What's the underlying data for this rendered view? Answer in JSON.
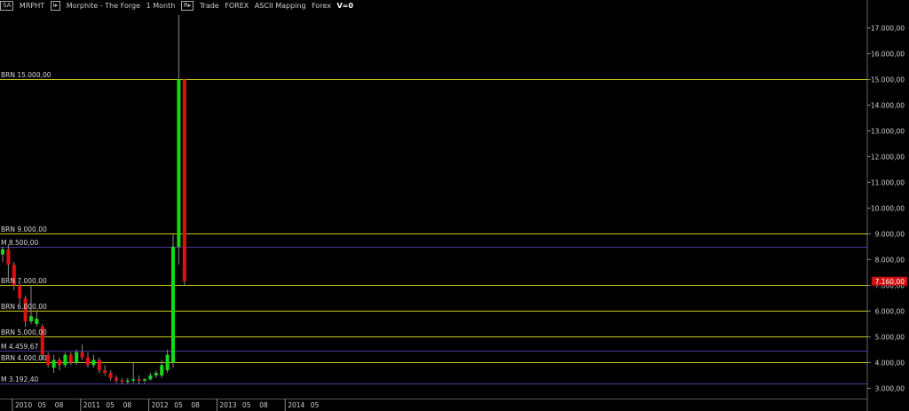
{
  "header": {
    "symbol_box": "SA",
    "symbol": "MRPHT",
    "box2": "I▸",
    "title": "Morphite - The Forge",
    "period": "1 Month",
    "box3": "R▸",
    "mode": "Trade",
    "market": "FOREX",
    "mapping": "ASCII Mapping",
    "market2": "Forex",
    "vol": "V=0"
  },
  "colors": {
    "up": "#16d916",
    "down": "#e01010",
    "brn_line": "#c8c81e",
    "m_line": "#4a3aa0",
    "axis_text": "#d0d0d0",
    "price_tag": "#d01010"
  },
  "chart_data": {
    "type": "candlestick",
    "ylim": [
      2600,
      17600
    ],
    "y_ticks": [
      {
        "value": 3000,
        "label": "3.000,00"
      },
      {
        "value": 4000,
        "label": "4.000,00"
      },
      {
        "value": 5000,
        "label": "5.000,00"
      },
      {
        "value": 6000,
        "label": "6.000,00"
      },
      {
        "value": 7000,
        "label": "7.000,00"
      },
      {
        "value": 8000,
        "label": "8.000,00"
      },
      {
        "value": 9000,
        "label": "9.000,00"
      },
      {
        "value": 10000,
        "label": "10.000,00"
      },
      {
        "value": 11000,
        "label": "11.000,00"
      },
      {
        "value": 12000,
        "label": "12.000,00"
      },
      {
        "value": 13000,
        "label": "13.000,00"
      },
      {
        "value": 14000,
        "label": "14.000,00"
      },
      {
        "value": 15000,
        "label": "15.000,00"
      },
      {
        "value": 16000,
        "label": "16.000,00"
      },
      {
        "value": 17000,
        "label": "17.000,00"
      }
    ],
    "x_labels": [
      {
        "index": 0,
        "label": "2010",
        "year": true
      },
      {
        "index": 4,
        "label": "05",
        "year": false
      },
      {
        "index": 7,
        "label": "08",
        "year": false
      },
      {
        "index": 12,
        "label": "2011",
        "year": true
      },
      {
        "index": 16,
        "label": "05",
        "year": false
      },
      {
        "index": 19,
        "label": "08",
        "year": false
      },
      {
        "index": 24,
        "label": "2012",
        "year": true
      },
      {
        "index": 28,
        "label": "05",
        "year": false
      },
      {
        "index": 31,
        "label": "08",
        "year": false
      },
      {
        "index": 36,
        "label": "2013",
        "year": true
      },
      {
        "index": 40,
        "label": "05",
        "year": false
      },
      {
        "index": 43,
        "label": "08",
        "year": false
      },
      {
        "index": 48,
        "label": "2014",
        "year": true
      },
      {
        "index": 52,
        "label": "05",
        "year": false
      }
    ],
    "hlines": [
      {
        "value": 15000,
        "label": "BRN 15.000,00",
        "kind": "brn"
      },
      {
        "value": 9000,
        "label": "BRN 9.000,00",
        "kind": "brn"
      },
      {
        "value": 8500,
        "label": "M 8.500,00",
        "kind": "m"
      },
      {
        "value": 7000,
        "label": "BRN 7.000,00",
        "kind": "brn"
      },
      {
        "value": 6000,
        "label": "BRN 6.000,00",
        "kind": "brn"
      },
      {
        "value": 5000,
        "label": "BRN 5.000,00",
        "kind": "brn"
      },
      {
        "value": 4459.67,
        "label": "M 4.459,67",
        "kind": "m"
      },
      {
        "value": 4000,
        "label": "BRN 4.000,00",
        "kind": "brn"
      },
      {
        "value": 3192.4,
        "label": "M 3.192,40",
        "kind": "m"
      }
    ],
    "last_price": {
      "value": 7160,
      "label": "7.160,00"
    },
    "candles": [
      {
        "o": 8200,
        "h": 8500,
        "l": 7900,
        "c": 8400
      },
      {
        "o": 8400,
        "h": 8600,
        "l": 7300,
        "c": 7800
      },
      {
        "o": 7800,
        "h": 7900,
        "l": 6800,
        "c": 7000
      },
      {
        "o": 7000,
        "h": 7100,
        "l": 6300,
        "c": 6500
      },
      {
        "o": 6500,
        "h": 6600,
        "l": 5400,
        "c": 5600
      },
      {
        "o": 5600,
        "h": 7000,
        "l": 5500,
        "c": 5800
      },
      {
        "o": 5500,
        "h": 6000,
        "l": 5400,
        "c": 5700
      },
      {
        "o": 5400,
        "h": 5500,
        "l": 4100,
        "c": 4300
      },
      {
        "o": 4300,
        "h": 4400,
        "l": 3800,
        "c": 3900
      },
      {
        "o": 3800,
        "h": 4300,
        "l": 3600,
        "c": 4100
      },
      {
        "o": 4100,
        "h": 4200,
        "l": 3700,
        "c": 3900
      },
      {
        "o": 3900,
        "h": 4400,
        "l": 3800,
        "c": 4300
      },
      {
        "o": 4300,
        "h": 4400,
        "l": 3900,
        "c": 4000
      },
      {
        "o": 4000,
        "h": 4500,
        "l": 3900,
        "c": 4400
      },
      {
        "o": 4400,
        "h": 4700,
        "l": 4100,
        "c": 4200
      },
      {
        "o": 4200,
        "h": 4400,
        "l": 3800,
        "c": 3900
      },
      {
        "o": 3900,
        "h": 4300,
        "l": 3800,
        "c": 4100
      },
      {
        "o": 4100,
        "h": 4200,
        "l": 3600,
        "c": 3700
      },
      {
        "o": 3700,
        "h": 3900,
        "l": 3500,
        "c": 3600
      },
      {
        "o": 3600,
        "h": 3700,
        "l": 3300,
        "c": 3400
      },
      {
        "o": 3400,
        "h": 3500,
        "l": 3200,
        "c": 3300
      },
      {
        "o": 3300,
        "h": 3400,
        "l": 3150,
        "c": 3250
      },
      {
        "o": 3250,
        "h": 3400,
        "l": 3150,
        "c": 3300
      },
      {
        "o": 3300,
        "h": 4000,
        "l": 3200,
        "c": 3350
      },
      {
        "o": 3350,
        "h": 3500,
        "l": 3150,
        "c": 3300
      },
      {
        "o": 3300,
        "h": 3400,
        "l": 3200,
        "c": 3350
      },
      {
        "o": 3350,
        "h": 3600,
        "l": 3300,
        "c": 3500
      },
      {
        "o": 3500,
        "h": 3700,
        "l": 3400,
        "c": 3600
      },
      {
        "o": 3500,
        "h": 4100,
        "l": 3400,
        "c": 3900
      },
      {
        "o": 3700,
        "h": 4500,
        "l": 3600,
        "c": 4300
      },
      {
        "o": 4000,
        "h": 9000,
        "l": 3800,
        "c": 8500
      },
      {
        "o": 8500,
        "h": 17500,
        "l": 7800,
        "c": 15000
      },
      {
        "o": 15000,
        "h": 15000,
        "l": 7000,
        "c": 7160
      }
    ]
  }
}
